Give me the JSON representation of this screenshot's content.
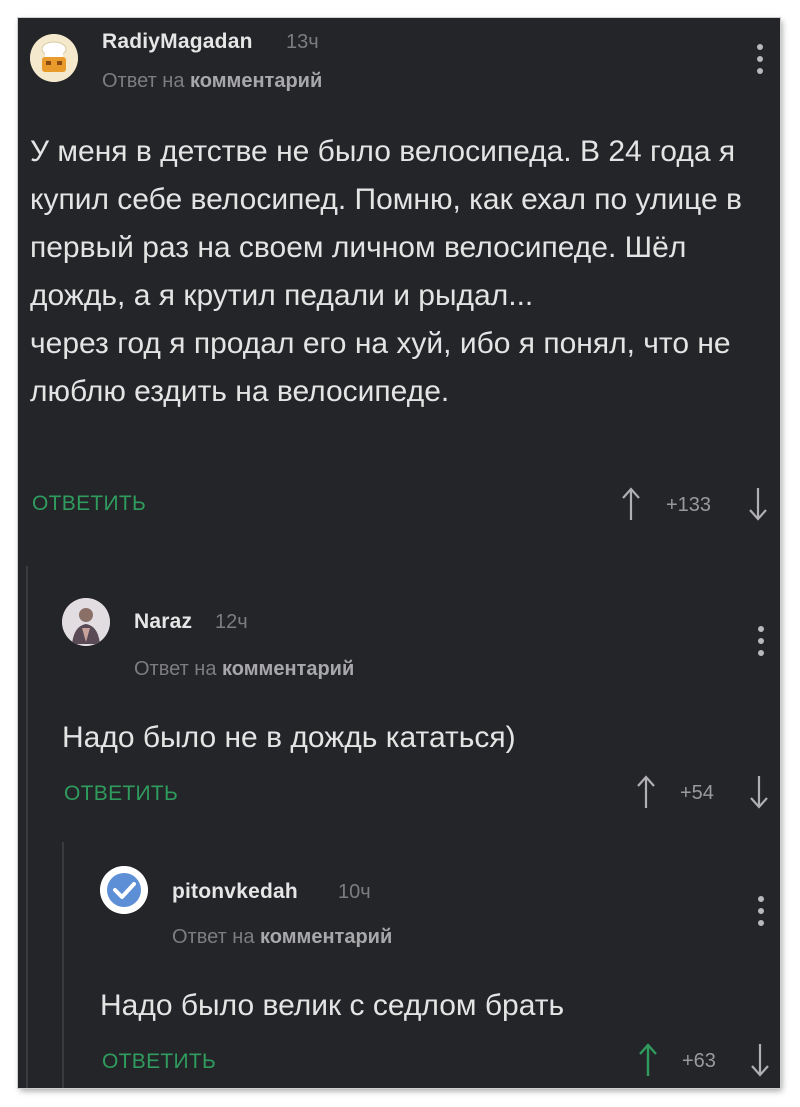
{
  "comments": [
    {
      "username": "RadiyMagadan",
      "time": "13ч",
      "reply_prefix": "Ответ на",
      "reply_target": "комментарий",
      "text": "У меня в детстве не было велосипеда. В 24 года я купил себе велосипед. Помню, как ехал по улице в первый раз на своем личном велосипеде. Шёл дождь, а я крутил педали и рыдал...\nчерез год я продал его на хуй, ибо я понял, что не люблю ездить на велосипеде.",
      "reply_label": "ОТВЕТИТЬ",
      "score": "+133",
      "upvoted": false
    },
    {
      "username": "Naraz",
      "time": "12ч",
      "reply_prefix": "Ответ на",
      "reply_target": "комментарий",
      "text": "Надо было не в дождь кататься)",
      "reply_label": "ОТВЕТИТЬ",
      "score": "+54",
      "upvoted": false
    },
    {
      "username": "pitonvkedah",
      "time": "10ч",
      "reply_prefix": "Ответ на",
      "reply_target": "комментарий",
      "text": "Надо было велик с седлом брать",
      "reply_label": "ОТВЕТИТЬ",
      "score": "+63",
      "upvoted": true
    }
  ],
  "colors": {
    "background": "#242528",
    "accent_green": "#2f9c5e",
    "text": "#e4e4e4",
    "muted": "#7d7d80"
  },
  "icons": [
    "chef-avatar-icon",
    "user-photo-avatar",
    "verified-check-avatar-icon",
    "more-vert-icon",
    "arrow-up-icon",
    "arrow-down-icon"
  ]
}
